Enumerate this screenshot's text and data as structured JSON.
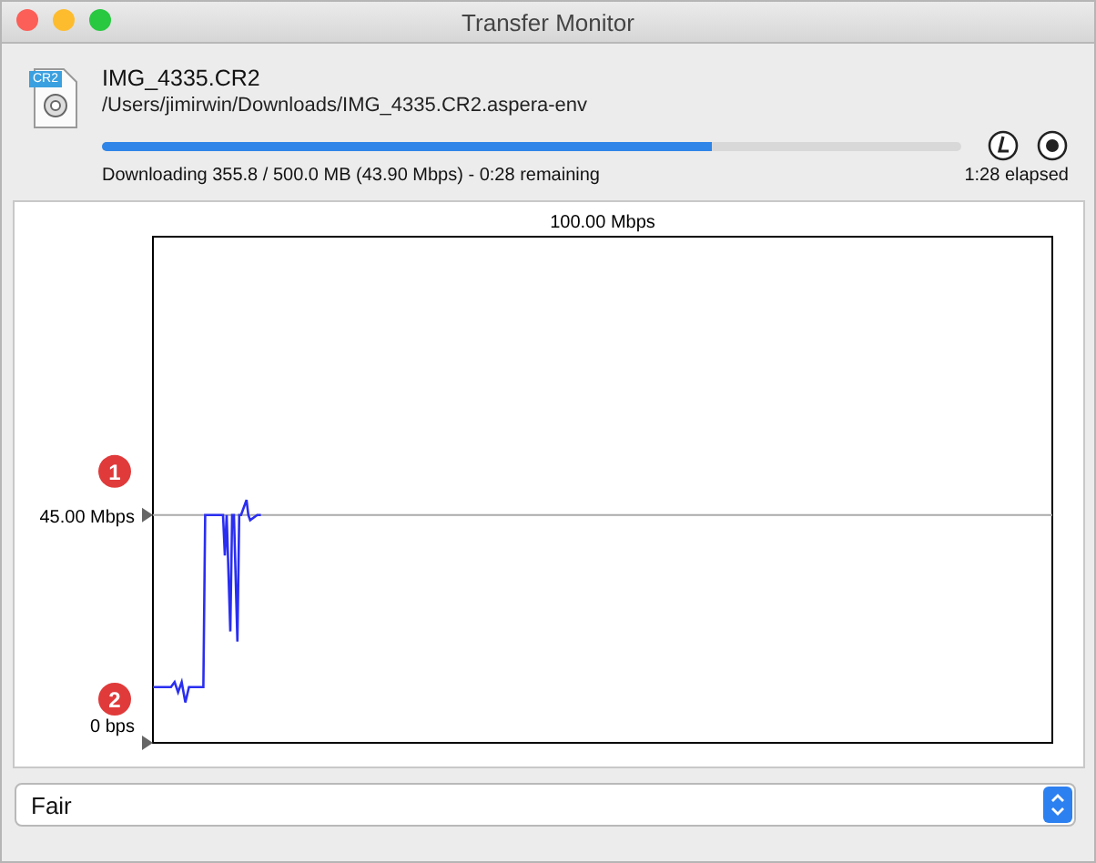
{
  "window": {
    "title": "Transfer Monitor"
  },
  "transfer": {
    "file_badge": "CR2",
    "filename": "IMG_4335.CR2",
    "path": "/Users/jimirwin/Downloads/IMG_4335.CR2.aspera-env",
    "progress": {
      "level": 0.71
    },
    "status": "Downloading 355.8 / 500.0 MB (43.90 Mbps) - 0:28 remaining",
    "elapsed": "1:28 elapsed"
  },
  "graph": {
    "max_label": "100.00 Mbps",
    "threshold_label": "45.00 Mbps",
    "floor_label": "0 bps",
    "markers": [
      {
        "label": "1"
      },
      {
        "label": "2"
      }
    ]
  },
  "policy": {
    "value": "Fair"
  }
}
